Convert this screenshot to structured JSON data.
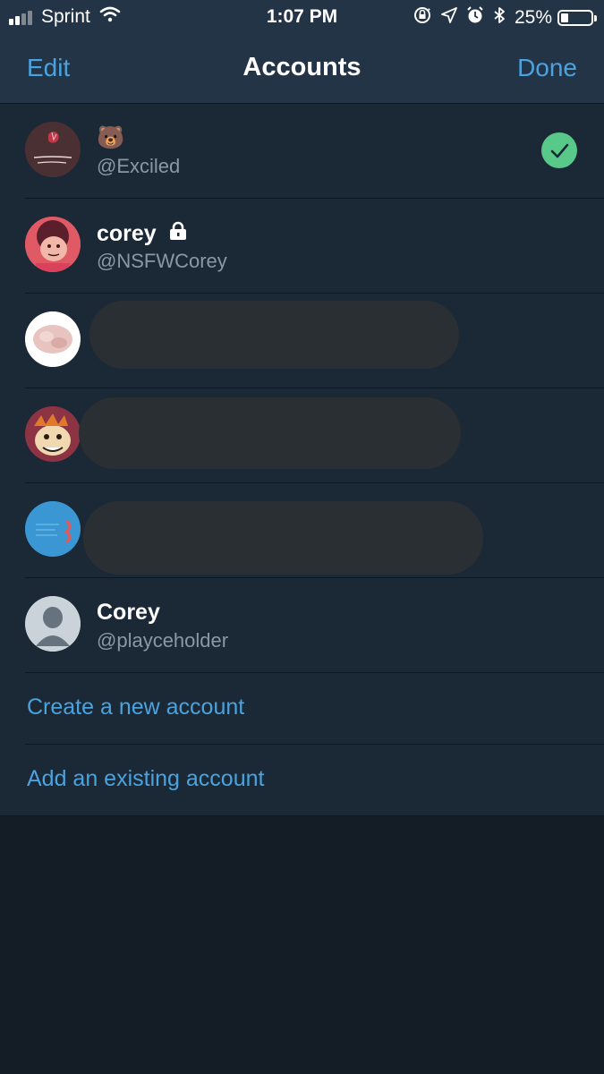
{
  "status_bar": {
    "carrier": "Sprint",
    "time": "1:07 PM",
    "battery_percent": "25%",
    "battery_level": 0.25,
    "signal_bars_filled": 2,
    "icons": [
      "signal-icon",
      "wifi-icon",
      "orientation-lock-icon",
      "location-icon",
      "alarm-icon",
      "bluetooth-icon",
      "battery-icon"
    ]
  },
  "nav": {
    "edit_label": "Edit",
    "title": "Accounts",
    "done_label": "Done"
  },
  "accounts": [
    {
      "name": "🐻",
      "handle": "@Exciled",
      "selected": true,
      "protected": false,
      "redacted": false
    },
    {
      "name": "corey",
      "handle": "@NSFWCorey",
      "selected": false,
      "protected": true,
      "redacted": false
    },
    {
      "name": "",
      "handle": "",
      "selected": false,
      "protected": false,
      "redacted": true
    },
    {
      "name": "",
      "handle": "",
      "selected": false,
      "protected": false,
      "redacted": true
    },
    {
      "name": "",
      "handle": "",
      "selected": false,
      "protected": false,
      "redacted": true
    },
    {
      "name": "Corey",
      "handle": "@playceholder",
      "selected": false,
      "protected": false,
      "redacted": false
    }
  ],
  "actions": {
    "create_label": "Create a new account",
    "add_label": "Add an existing account"
  },
  "colors": {
    "accent": "#4aa3df",
    "nav_background": "#243447",
    "list_background": "#1b2836",
    "page_background": "#141d26",
    "check_green": "#59c98a"
  }
}
